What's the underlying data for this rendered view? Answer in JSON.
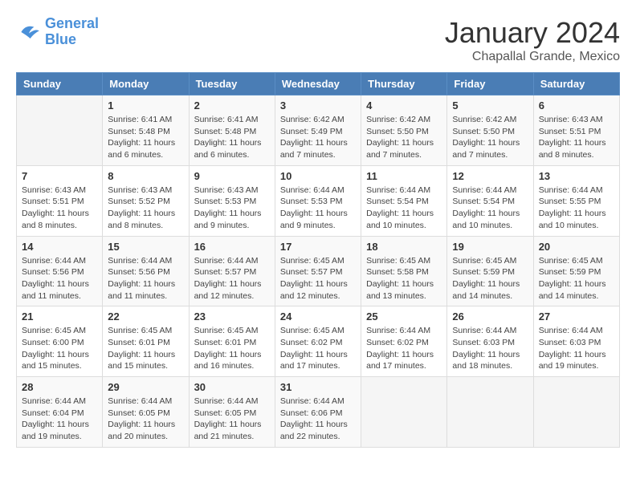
{
  "logo": {
    "line1": "General",
    "line2": "Blue"
  },
  "title": "January 2024",
  "location": "Chapallal Grande, Mexico",
  "days_of_week": [
    "Sunday",
    "Monday",
    "Tuesday",
    "Wednesday",
    "Thursday",
    "Friday",
    "Saturday"
  ],
  "weeks": [
    [
      {
        "day": "",
        "info": ""
      },
      {
        "day": "1",
        "info": "Sunrise: 6:41 AM\nSunset: 5:48 PM\nDaylight: 11 hours\nand 6 minutes."
      },
      {
        "day": "2",
        "info": "Sunrise: 6:41 AM\nSunset: 5:48 PM\nDaylight: 11 hours\nand 6 minutes."
      },
      {
        "day": "3",
        "info": "Sunrise: 6:42 AM\nSunset: 5:49 PM\nDaylight: 11 hours\nand 7 minutes."
      },
      {
        "day": "4",
        "info": "Sunrise: 6:42 AM\nSunset: 5:50 PM\nDaylight: 11 hours\nand 7 minutes."
      },
      {
        "day": "5",
        "info": "Sunrise: 6:42 AM\nSunset: 5:50 PM\nDaylight: 11 hours\nand 7 minutes."
      },
      {
        "day": "6",
        "info": "Sunrise: 6:43 AM\nSunset: 5:51 PM\nDaylight: 11 hours\nand 8 minutes."
      }
    ],
    [
      {
        "day": "7",
        "info": "Sunrise: 6:43 AM\nSunset: 5:51 PM\nDaylight: 11 hours\nand 8 minutes."
      },
      {
        "day": "8",
        "info": "Sunrise: 6:43 AM\nSunset: 5:52 PM\nDaylight: 11 hours\nand 8 minutes."
      },
      {
        "day": "9",
        "info": "Sunrise: 6:43 AM\nSunset: 5:53 PM\nDaylight: 11 hours\nand 9 minutes."
      },
      {
        "day": "10",
        "info": "Sunrise: 6:44 AM\nSunset: 5:53 PM\nDaylight: 11 hours\nand 9 minutes."
      },
      {
        "day": "11",
        "info": "Sunrise: 6:44 AM\nSunset: 5:54 PM\nDaylight: 11 hours\nand 10 minutes."
      },
      {
        "day": "12",
        "info": "Sunrise: 6:44 AM\nSunset: 5:54 PM\nDaylight: 11 hours\nand 10 minutes."
      },
      {
        "day": "13",
        "info": "Sunrise: 6:44 AM\nSunset: 5:55 PM\nDaylight: 11 hours\nand 10 minutes."
      }
    ],
    [
      {
        "day": "14",
        "info": "Sunrise: 6:44 AM\nSunset: 5:56 PM\nDaylight: 11 hours\nand 11 minutes."
      },
      {
        "day": "15",
        "info": "Sunrise: 6:44 AM\nSunset: 5:56 PM\nDaylight: 11 hours\nand 11 minutes."
      },
      {
        "day": "16",
        "info": "Sunrise: 6:44 AM\nSunset: 5:57 PM\nDaylight: 11 hours\nand 12 minutes."
      },
      {
        "day": "17",
        "info": "Sunrise: 6:45 AM\nSunset: 5:57 PM\nDaylight: 11 hours\nand 12 minutes."
      },
      {
        "day": "18",
        "info": "Sunrise: 6:45 AM\nSunset: 5:58 PM\nDaylight: 11 hours\nand 13 minutes."
      },
      {
        "day": "19",
        "info": "Sunrise: 6:45 AM\nSunset: 5:59 PM\nDaylight: 11 hours\nand 14 minutes."
      },
      {
        "day": "20",
        "info": "Sunrise: 6:45 AM\nSunset: 5:59 PM\nDaylight: 11 hours\nand 14 minutes."
      }
    ],
    [
      {
        "day": "21",
        "info": "Sunrise: 6:45 AM\nSunset: 6:00 PM\nDaylight: 11 hours\nand 15 minutes."
      },
      {
        "day": "22",
        "info": "Sunrise: 6:45 AM\nSunset: 6:01 PM\nDaylight: 11 hours\nand 15 minutes."
      },
      {
        "day": "23",
        "info": "Sunrise: 6:45 AM\nSunset: 6:01 PM\nDaylight: 11 hours\nand 16 minutes."
      },
      {
        "day": "24",
        "info": "Sunrise: 6:45 AM\nSunset: 6:02 PM\nDaylight: 11 hours\nand 17 minutes."
      },
      {
        "day": "25",
        "info": "Sunrise: 6:44 AM\nSunset: 6:02 PM\nDaylight: 11 hours\nand 17 minutes."
      },
      {
        "day": "26",
        "info": "Sunrise: 6:44 AM\nSunset: 6:03 PM\nDaylight: 11 hours\nand 18 minutes."
      },
      {
        "day": "27",
        "info": "Sunrise: 6:44 AM\nSunset: 6:03 PM\nDaylight: 11 hours\nand 19 minutes."
      }
    ],
    [
      {
        "day": "28",
        "info": "Sunrise: 6:44 AM\nSunset: 6:04 PM\nDaylight: 11 hours\nand 19 minutes."
      },
      {
        "day": "29",
        "info": "Sunrise: 6:44 AM\nSunset: 6:05 PM\nDaylight: 11 hours\nand 20 minutes."
      },
      {
        "day": "30",
        "info": "Sunrise: 6:44 AM\nSunset: 6:05 PM\nDaylight: 11 hours\nand 21 minutes."
      },
      {
        "day": "31",
        "info": "Sunrise: 6:44 AM\nSunset: 6:06 PM\nDaylight: 11 hours\nand 22 minutes."
      },
      {
        "day": "",
        "info": ""
      },
      {
        "day": "",
        "info": ""
      },
      {
        "day": "",
        "info": ""
      }
    ]
  ]
}
